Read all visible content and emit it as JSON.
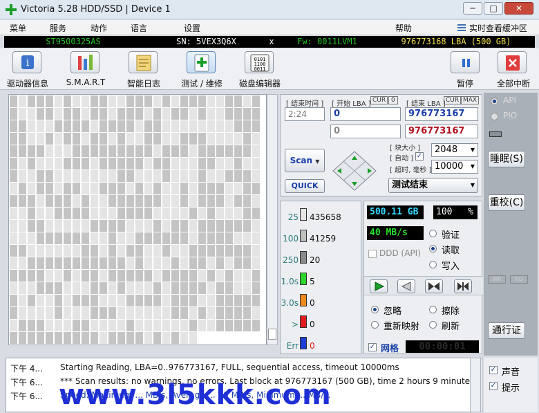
{
  "window": {
    "title": "Victoria 5.28 HDD/SSD | Device 1",
    "minimize": "─",
    "maximize": "□",
    "close": "✕"
  },
  "menu": {
    "items": [
      "菜单",
      "服务",
      "动作",
      "语言",
      "设置",
      "帮助"
    ],
    "realtime_buffer": "实时查看缓冲区"
  },
  "drive_info": {
    "model": "ST9500325AS",
    "serial": "SN: 5VEX3Q6X",
    "separator": "x",
    "firmware": "Fw: 0011LVM1",
    "capacity": "976773168 LBA (500 GB)"
  },
  "toolbar": {
    "buttons": [
      {
        "label": "驱动器信息",
        "icon": "info-icon"
      },
      {
        "label": "S.M.A.R.T",
        "icon": "smart-icon"
      },
      {
        "label": "智能日志",
        "icon": "log-icon"
      },
      {
        "label": "测试 / 维修",
        "icon": "test-icon"
      },
      {
        "label": "磁盘编辑器",
        "icon": "disk-editor-icon"
      }
    ],
    "pause": "暂停",
    "break_all": "全部中断"
  },
  "scan": {
    "end_time_label": "[ 结束时间 ]",
    "time_value": "2:24",
    "start_lba_label": "[ 开始 LBA ]",
    "cur_label": "CUR",
    "start_zero": "0",
    "start_lba": "0",
    "start_lba2": "0",
    "end_lba_label": "[ 结束 LBA ]",
    "end_cur_label": "CUR",
    "max_label": "MAX",
    "end_lba": "976773167",
    "end_lba2": "976773167",
    "block_size_label": "[ 块大小 ]",
    "auto_label": "[ 自动 ]",
    "timeout_label": "[ 超时, 毫秒 ]",
    "block_size": "2048",
    "timeout": "10000",
    "scan_button": "Scan",
    "quick_button": "QUICK",
    "status": "测试结束",
    "api": "API",
    "pio": "PIO"
  },
  "side_buttons": {
    "sleep": "睡眠(S)",
    "recalibrate": "重校(C)",
    "wr": "WR",
    "rd": "RD",
    "passport": "通行证"
  },
  "legend": [
    {
      "label": "25",
      "count": "435658",
      "color": "#e6e6e6"
    },
    {
      "label": "100",
      "count": "41259",
      "color": "#c0c0c0"
    },
    {
      "label": "250",
      "count": "20",
      "color": "#8a8a8a"
    },
    {
      "label": "1.0s",
      "count": "5",
      "color": "#2bd52b"
    },
    {
      "label": "3.0s",
      "count": "0",
      "color": "#f08a1a"
    },
    {
      "label": ">",
      "count": "0",
      "color": "#e11d1d"
    },
    {
      "label": "Err",
      "count": "0",
      "color": "#1d3fd6"
    }
  ],
  "stats": {
    "size": "500.11 GB",
    "percent": "100",
    "percent_sign": "%",
    "speed": "40 MB/s",
    "ddd_api": "DDD (API)",
    "verify": "验证",
    "read": "读取",
    "write": "写入",
    "ignore": "忽略",
    "erase": "擦除",
    "remap": "重新映射",
    "refresh": "刷新",
    "grid_label": "网格",
    "timer": "00:00:01"
  },
  "log": {
    "rows": [
      {
        "time": "下午 4...",
        "text": "Starting Reading, LBA=0..976773167, FULL, sequential access, timeout 10000ms"
      },
      {
        "time": "下午 6...",
        "text": "*** Scan results: no warnings, no errors. Last block at 976773167 (500 GB), time 2 hours 9 minute..."
      },
      {
        "time": "下午 6...",
        "text": "Speed: Maximum ... MB/s, Average ... 60 MB/s, Minimum ... MB/s."
      }
    ],
    "sound": "声音",
    "hint": "提示"
  },
  "watermark": "www.3l5kkk.com",
  "colors": {
    "title_bg": "#dfe7f1",
    "info_green": "#27c427",
    "info_yellow": "#f5e14a",
    "lcd_cyan": "#38d9ff",
    "lcd_green": "#27e027"
  }
}
